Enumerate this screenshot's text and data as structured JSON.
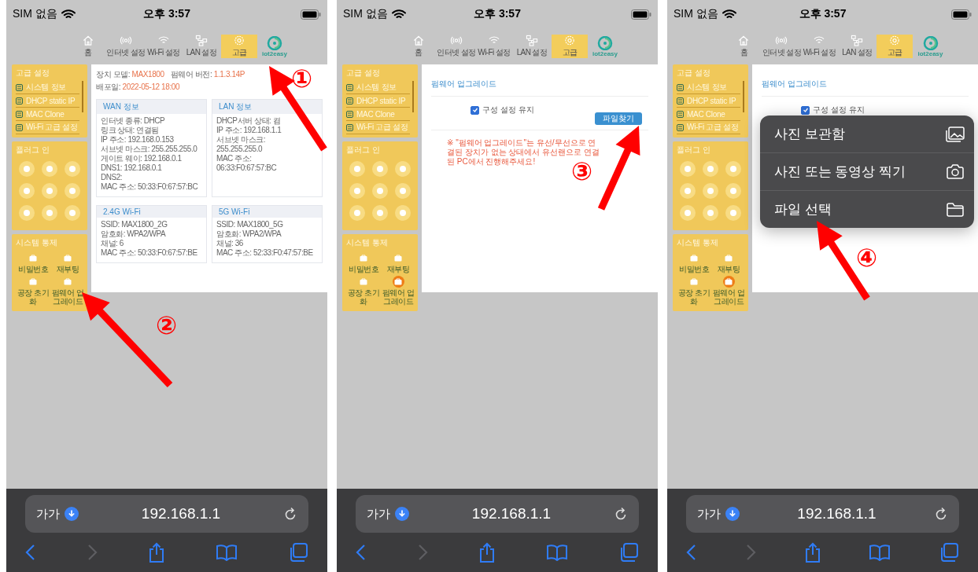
{
  "phones": [
    {
      "status_bar": {
        "carrier": "SIM 없음",
        "time": "오후 3:57"
      },
      "nav": [
        {
          "label": "홈",
          "selected": false
        },
        {
          "label": "인터넷 설정",
          "selected": false
        },
        {
          "label": "Wi-Fi 설정",
          "selected": false
        },
        {
          "label": "LAN 설정",
          "selected": false
        },
        {
          "label": "고급",
          "selected": true
        }
      ],
      "logo": "iot2easy",
      "sidebar": {
        "settings_title": "고급 설정",
        "settings_items": [
          "시스템 정보",
          "DHCP static IP",
          "MAC Clone",
          "Wi-Fi 고급 설정"
        ],
        "plugin_title": "플러그 인",
        "system_title": "시스템 통제",
        "system_items": [
          {
            "label": "비밀번호",
            "selected": false
          },
          {
            "label": "재부팅",
            "selected": false
          },
          {
            "label": "공장 초기화",
            "selected": false
          },
          {
            "label": "펌웨어 업그레이드",
            "selected": false
          }
        ]
      },
      "page": {
        "kind": "status",
        "header": [
          {
            "label": "장치 모델:",
            "value": "MAX1800"
          },
          {
            "label": "펌웨어 버전:",
            "value": "1.1.3.14P"
          },
          {
            "label": "배포일:",
            "value": "2022-05-12 18:00"
          }
        ],
        "boxes": [
          {
            "title": "WAN 정보",
            "lines": [
              "인터넷 종류: DHCP",
              "링크 상태: 연결됨",
              "IP 주소: 192.168.0.153",
              "서브넷 마스크: 255.255.255.0",
              "게이트 웨이: 192.168.0.1",
              "DNS1: 192.168.0.1",
              "DNS2:",
              "MAC 주소: 50:33:F0:67:57:BC"
            ]
          },
          {
            "title": "LAN 정보",
            "lines": [
              "DHCP서버 상태: 켬",
              "IP 주소: 192.168.1.1",
              "서브넷 마스크: 255.255.255.0",
              "MAC 주소: 06:33:F0:67:57:BC"
            ]
          },
          {
            "title": "2.4G Wi-Fi",
            "lines": [
              "SSID: MAX1800_2G",
              "암호화: WPA2/WPA",
              "채널: 6",
              "MAC 주소: 50:33:F0:67:57:BE"
            ]
          },
          {
            "title": "5G Wi-Fi",
            "lines": [
              "SSID: MAX1800_5G",
              "암호화: WPA2/WPA",
              "채널: 36",
              "MAC 주소: 52:33:F0:47:57:BE"
            ]
          }
        ]
      },
      "address_bar": {
        "text_size": "가가",
        "url": "192.168.1.1"
      },
      "toolbar": {
        "forward_enabled": false
      },
      "annotations": [
        "①",
        "②"
      ]
    },
    {
      "status_bar": {
        "carrier": "SIM 없음",
        "time": "오후 3:57"
      },
      "nav": [
        {
          "label": "홈",
          "selected": false
        },
        {
          "label": "인터넷 설정",
          "selected": false
        },
        {
          "label": "Wi-Fi 설정",
          "selected": false
        },
        {
          "label": "LAN 설정",
          "selected": false
        },
        {
          "label": "고급",
          "selected": true
        }
      ],
      "logo": "iot2easy",
      "sidebar": {
        "settings_title": "고급 설정",
        "settings_items": [
          "시스템 정보",
          "DHCP static IP",
          "MAC Clone",
          "Wi-Fi 고급 설정"
        ],
        "plugin_title": "플러그 인",
        "system_title": "시스템 통제",
        "system_items": [
          {
            "label": "비밀번호",
            "selected": false
          },
          {
            "label": "재부팅",
            "selected": false
          },
          {
            "label": "공장 초기화",
            "selected": false
          },
          {
            "label": "펌웨어 업그레이드",
            "selected": true
          }
        ]
      },
      "page": {
        "kind": "upgrade",
        "title": "펌웨어 업그레이드",
        "keep_settings": {
          "label": "구성 설정 유지",
          "checked": true
        },
        "button": "파일찾기",
        "note": "※ \"펌웨어 업그레이드\"는 유선/무선으로 연결된 장치가 없는 상태에서 유선랜으로 연결된 PC에서 진행해주세요!"
      },
      "address_bar": {
        "text_size": "가가",
        "url": "192.168.1.1"
      },
      "toolbar": {
        "forward_enabled": false
      },
      "annotations": [
        "③"
      ]
    },
    {
      "status_bar": {
        "carrier": "SIM 없음",
        "time": "오후 3:57"
      },
      "nav": [
        {
          "label": "홈",
          "selected": false
        },
        {
          "label": "인터넷 설정",
          "selected": false
        },
        {
          "label": "Wi-Fi 설정",
          "selected": false
        },
        {
          "label": "LAN 설정",
          "selected": false
        },
        {
          "label": "고급",
          "selected": true
        }
      ],
      "logo": "iot2easy",
      "sidebar": {
        "settings_title": "고급 설정",
        "settings_items": [
          "시스템 정보",
          "DHCP static IP",
          "MAC Clone",
          "Wi-Fi 고급 설정"
        ],
        "plugin_title": "플러그 인",
        "system_title": "시스템 통제",
        "system_items": [
          {
            "label": "비밀번호",
            "selected": false
          },
          {
            "label": "재부팅",
            "selected": false
          },
          {
            "label": "공장 초기화",
            "selected": false
          },
          {
            "label": "펌웨어 업그레이드",
            "selected": true
          }
        ]
      },
      "page": {
        "kind": "upgrade",
        "title": "펌웨어 업그레이드",
        "keep_settings": {
          "label": "구성 설정 유지",
          "checked": true
        }
      },
      "menu": [
        "사진 보관함",
        "사진 또는 동영상 찍기",
        "파일 선택"
      ],
      "address_bar": {
        "text_size": "가가",
        "url": "192.168.1.1"
      },
      "toolbar": {
        "forward_enabled": false
      },
      "annotations": [
        "④"
      ]
    }
  ]
}
